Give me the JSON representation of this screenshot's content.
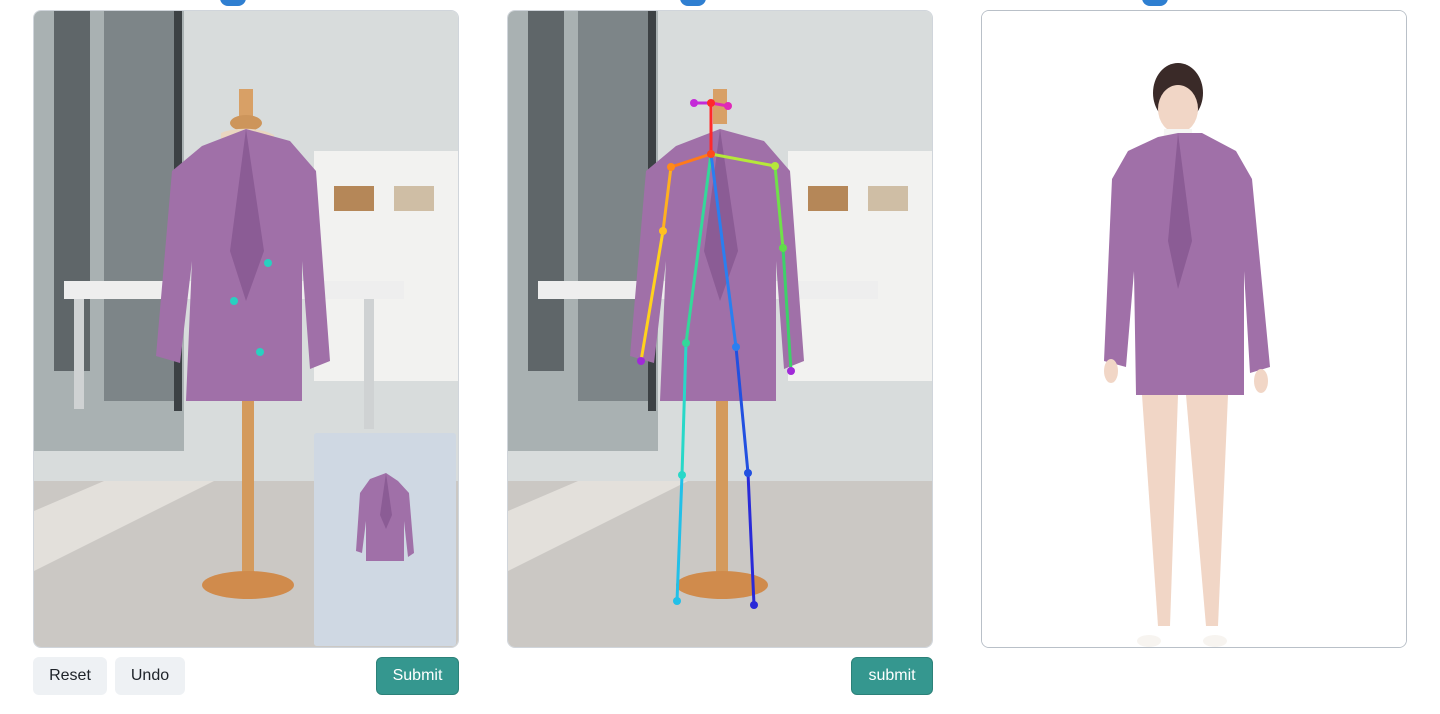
{
  "panel_left": {
    "controls": {
      "reset_label": "Reset",
      "undo_label": "Undo",
      "submit_label": "Submit"
    }
  },
  "panel_middle": {
    "controls": {
      "submit_label": "submit"
    }
  },
  "colors": {
    "accent_teal": "#35978f",
    "jacket": "#a070a8",
    "keypoint": "#29d0c0"
  },
  "icons": [
    "mannequin-photo",
    "garment-thumbnail",
    "pose-skeleton",
    "generated-model"
  ]
}
